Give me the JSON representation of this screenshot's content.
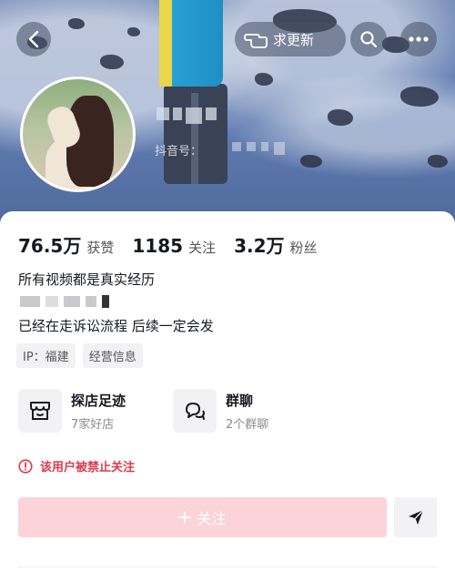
{
  "header": {
    "update_label": "求更新",
    "douyin_id_label": "抖音号："
  },
  "stats": [
    {
      "value": "76.5万",
      "label": "获赞"
    },
    {
      "value": "1185",
      "label": "关注"
    },
    {
      "value": "3.2万",
      "label": "粉丝"
    }
  ],
  "bio": {
    "line1": "所有视频都是真实经历",
    "line2": "已经在走诉讼流程 后续一定会发"
  },
  "tags": [
    "IP：福建",
    "经营信息"
  ],
  "features": [
    {
      "title": "探店足迹",
      "subtitle": "7家好店",
      "icon": "shop-icon"
    },
    {
      "title": "群聊",
      "subtitle": "2个群聊",
      "icon": "chat-icon"
    }
  ],
  "ban_notice": "该用户被禁止关注",
  "follow_label": "关注",
  "colors": {
    "follow_disabled": "#fbd3d9",
    "ban_red": "#e0394b",
    "banner_blue": "#5f7bb0"
  }
}
